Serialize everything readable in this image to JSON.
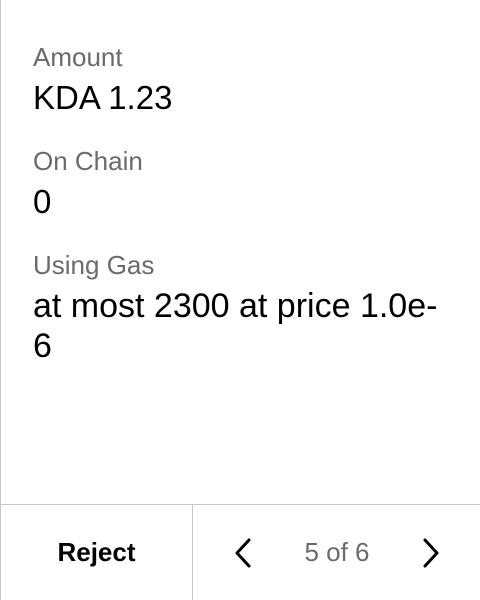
{
  "fields": {
    "amount": {
      "label": "Amount",
      "value": "KDA 1.23"
    },
    "chain": {
      "label": "On Chain",
      "value": "0"
    },
    "gas": {
      "label": "Using Gas",
      "value": "at most 2300 at price 1.0e-6"
    }
  },
  "footer": {
    "reject_label": "Reject",
    "prev_icon": "chevron-left-icon",
    "next_icon": "chevron-right-icon",
    "page_counter": "5 of 6"
  },
  "colors": {
    "label": "#6b6b6b",
    "value": "#000000",
    "divider": "#c8c8c8",
    "background": "#ffffff"
  }
}
